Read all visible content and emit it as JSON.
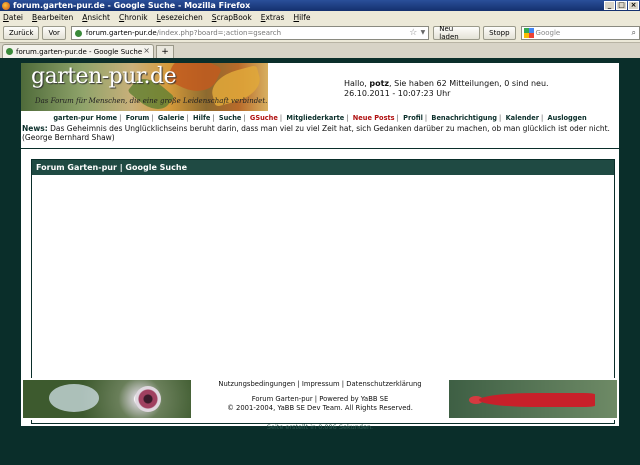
{
  "window": {
    "title": "forum.garten-pur.de - Google Suche - Mozilla Firefox",
    "controls": [
      "_",
      "□",
      "×"
    ]
  },
  "menu": [
    "Datei",
    "Bearbeiten",
    "Ansicht",
    "Chronik",
    "Lesezeichen",
    "ScrapBook",
    "Extras",
    "Hilfe"
  ],
  "nav": {
    "back": "Zurück",
    "forward": "Vor",
    "url_host": "forum.garten-pur.de",
    "url_path": "/index.php?board=;action=gsearch",
    "reload": "Neu laden",
    "stop": "Stopp",
    "search_placeholder": "Google"
  },
  "tab": {
    "label": "forum.garten-pur.de - Google Suche",
    "new_tab": "+"
  },
  "site": {
    "brand": "garten-pur.de",
    "slogan": "Das Forum für Menschen, die eine große Leidenschaft verbindet.",
    "greeting_pre": "Hallo, ",
    "user": "potz",
    "greeting_post": ", Sie haben 62 Mitteilungen, 0 sind neu.",
    "datetime": "26.10.2011 - 10:07:23 Uhr",
    "links": [
      "garten-pur Home",
      "Forum",
      "Galerie",
      "Hilfe",
      "Suche",
      "GSuche",
      "Mitgliederkarte",
      "Neue Posts",
      "Profil",
      "Benachrichtigung",
      "Kalender",
      "Ausloggen"
    ],
    "news_label": "News:",
    "news_text": " Das Geheimnis des Unglücklichseins beruht darin, dass man viel zu viel Zeit hat, sich Gedanken darüber zu machen, ob man glücklich ist oder nicht. (George Bernhard Shaw)",
    "pane_title": "Forum Garten-pur | Google Suche",
    "footer_links": [
      "Nutzungsbedingungen",
      "Impressum",
      "Datenschutzerklärung"
    ],
    "footer_line1": "Forum Garten-pur | Powered by YaBB SE",
    "footer_line2": "© 2001-2004, YaBB SE Dev Team. All Rights Reserved.",
    "page_time": "Seite erstellt in 0.096 Sekunden."
  }
}
